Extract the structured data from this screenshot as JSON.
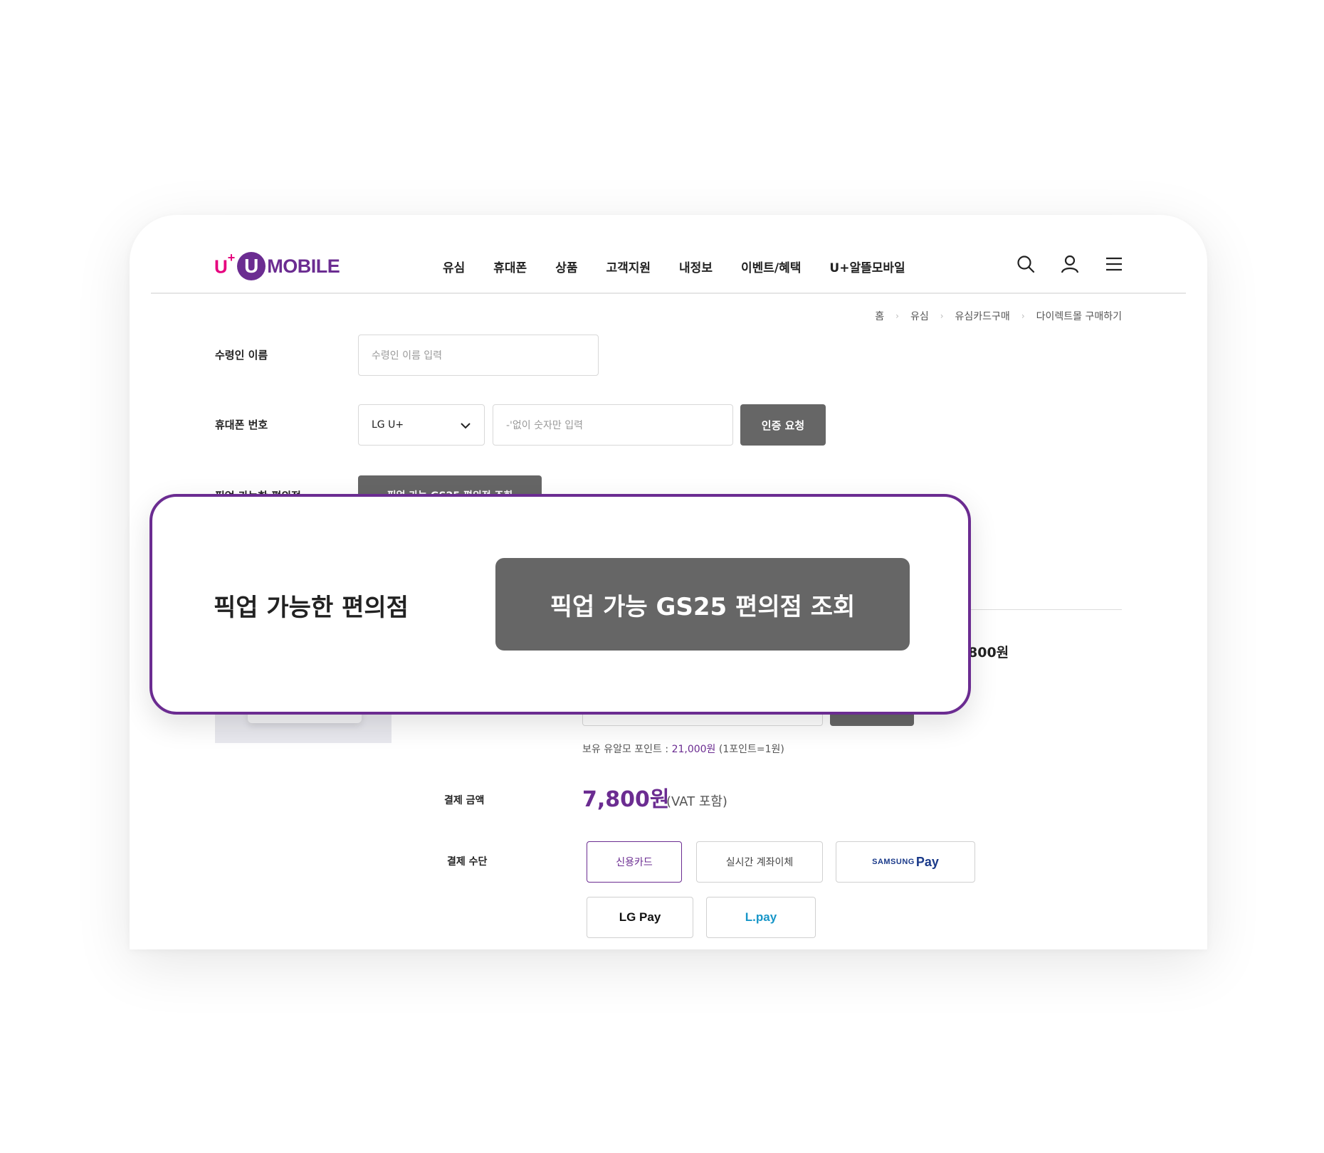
{
  "header": {
    "logo": {
      "prefix": "U",
      "plus": "+",
      "circle_letter": "U",
      "word": "MOBILE"
    },
    "nav": [
      "유심",
      "휴대폰",
      "상품",
      "고객지원",
      "내정보",
      "이벤트/혜택",
      "U+알뜰모바일"
    ],
    "icons": [
      "search-icon",
      "user-icon",
      "menu-icon"
    ]
  },
  "breadcrumb": [
    "홈",
    "유심",
    "유심카드구매",
    "다이렉트몰 구매하기"
  ],
  "form": {
    "recipient_label": "수령인 이름",
    "recipient_placeholder": "수령인 이름 입력",
    "phone_label": "휴대폰 번호",
    "carrier_value": "LG U+",
    "phone_placeholder": "-'없이 숫자만 입력",
    "verify_button": "인증 요청",
    "store_label_partial": "픽업 가능한 편의점",
    "store_button_partial": "픽업 가능 GS25 편의점 조회"
  },
  "summary": {
    "price_partial": "800원",
    "point_note_prefix": "보유 유알모 포인트 : ",
    "point_value": "21,000원",
    "point_note_suffix": " (1포인트=1원)",
    "payment_amount_label": "결제 금액",
    "payment_amount": "7,800원",
    "vat_note": "(VAT 포함)",
    "payment_method_label": "결제 수단",
    "methods": {
      "card": "신용카드",
      "transfer": "실시간 계좌이체",
      "samsung_small": "SAMSUNG",
      "samsung_big": "Pay",
      "lgpay": "LG Pay",
      "lpay": "L.pay"
    }
  },
  "callout": {
    "label": "픽업 가능한 편의점",
    "button": "픽업 가능 GS25 편의점 조회"
  },
  "colors": {
    "brand_purple": "#6b2c91",
    "brand_pink": "#e6007e",
    "button_gray": "#666666"
  }
}
